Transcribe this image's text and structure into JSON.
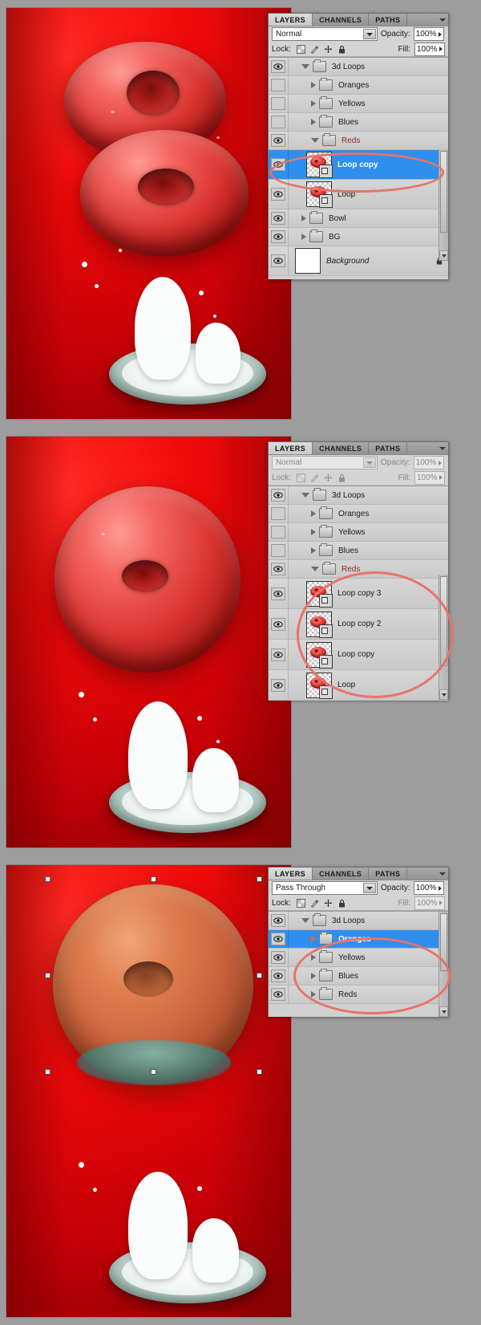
{
  "app": "Adobe Photoshop Layers Panel",
  "panel_tabs": [
    "LAYERS",
    "CHANNELS",
    "PATHS"
  ],
  "labels": {
    "opacity": "Opacity:",
    "fill": "Fill:",
    "lock": "Lock:",
    "lock_icons": [
      "lock-transparent-pixels-icon",
      "lock-image-pixels-icon",
      "lock-position-icon",
      "lock-all-icon"
    ]
  },
  "colors": {
    "selection_blue": "#2f8fef",
    "annotation_red": "#e8736b",
    "panel_gray": "#d4d4d4",
    "canvas_red": "#e8020a",
    "reds_label": "#8d2c22"
  },
  "screenshots": [
    {
      "id": "shot-1",
      "panel": {
        "active_tab": "LAYERS",
        "blend_mode": "Normal",
        "opacity": "100%",
        "fill": "100%",
        "controls_enabled": true,
        "layers": [
          {
            "name": "3d Loops",
            "type": "group",
            "indent": 0,
            "visible": true,
            "expanded": true,
            "selected": false
          },
          {
            "name": "Oranges",
            "type": "group",
            "indent": 1,
            "visible": false,
            "expanded": false,
            "selected": false
          },
          {
            "name": "Yellows",
            "type": "group",
            "indent": 1,
            "visible": false,
            "expanded": false,
            "selected": false
          },
          {
            "name": "Blues",
            "type": "group",
            "indent": 1,
            "visible": false,
            "expanded": false,
            "selected": false
          },
          {
            "name": "Reds",
            "type": "group",
            "indent": 1,
            "visible": true,
            "expanded": true,
            "selected": false
          },
          {
            "name": "Loop copy",
            "type": "3d-layer",
            "indent": 2,
            "visible": true,
            "selected": true
          },
          {
            "name": "Loop",
            "type": "3d-layer",
            "indent": 2,
            "visible": true,
            "selected": false
          },
          {
            "name": "Bowl",
            "type": "group",
            "indent": 0,
            "visible": true,
            "expanded": false,
            "selected": false
          },
          {
            "name": "BG",
            "type": "group",
            "indent": 0,
            "visible": true,
            "expanded": false,
            "selected": false
          },
          {
            "name": "Background",
            "type": "background",
            "indent": 0,
            "visible": true,
            "locked": true,
            "selected": false
          }
        ],
        "annotation": "ellipse-highlight-loop-copy"
      }
    },
    {
      "id": "shot-2",
      "panel": {
        "active_tab": "LAYERS",
        "blend_mode": "Normal",
        "opacity": "100%",
        "fill": "100%",
        "controls_enabled": false,
        "layers": [
          {
            "name": "3d Loops",
            "type": "group",
            "indent": 0,
            "visible": true,
            "expanded": true,
            "selected": false
          },
          {
            "name": "Oranges",
            "type": "group",
            "indent": 1,
            "visible": false,
            "expanded": false,
            "selected": false
          },
          {
            "name": "Yellows",
            "type": "group",
            "indent": 1,
            "visible": false,
            "expanded": false,
            "selected": false
          },
          {
            "name": "Blues",
            "type": "group",
            "indent": 1,
            "visible": false,
            "expanded": false,
            "selected": false
          },
          {
            "name": "Reds",
            "type": "group",
            "indent": 1,
            "visible": true,
            "expanded": true,
            "selected": false
          },
          {
            "name": "Loop copy 3",
            "type": "3d-layer",
            "indent": 2,
            "visible": true,
            "selected": false
          },
          {
            "name": "Loop copy 2",
            "type": "3d-layer",
            "indent": 2,
            "visible": true,
            "selected": false
          },
          {
            "name": "Loop copy",
            "type": "3d-layer",
            "indent": 2,
            "visible": true,
            "selected": false
          },
          {
            "name": "Loop",
            "type": "3d-layer",
            "indent": 2,
            "visible": true,
            "selected": false
          }
        ],
        "annotation": "ellipse-highlight-four-loop-layers"
      }
    },
    {
      "id": "shot-3",
      "panel": {
        "active_tab": "LAYERS",
        "blend_mode": "Pass Through",
        "opacity": "100%",
        "fill": "100%",
        "controls_enabled": true,
        "fill_enabled": false,
        "layers": [
          {
            "name": "3d Loops",
            "type": "group",
            "indent": 0,
            "visible": true,
            "expanded": true,
            "selected": false
          },
          {
            "name": "Oranges",
            "type": "group",
            "indent": 1,
            "visible": true,
            "expanded": false,
            "selected": true
          },
          {
            "name": "Yellows",
            "type": "group",
            "indent": 1,
            "visible": true,
            "expanded": false,
            "selected": false
          },
          {
            "name": "Blues",
            "type": "group",
            "indent": 1,
            "visible": true,
            "expanded": false,
            "selected": false
          },
          {
            "name": "Reds",
            "type": "group",
            "indent": 1,
            "visible": true,
            "expanded": false,
            "selected": false
          }
        ],
        "annotation": "ellipse-highlight-color-groups"
      },
      "canvas": {
        "transform_handles": true
      }
    }
  ]
}
